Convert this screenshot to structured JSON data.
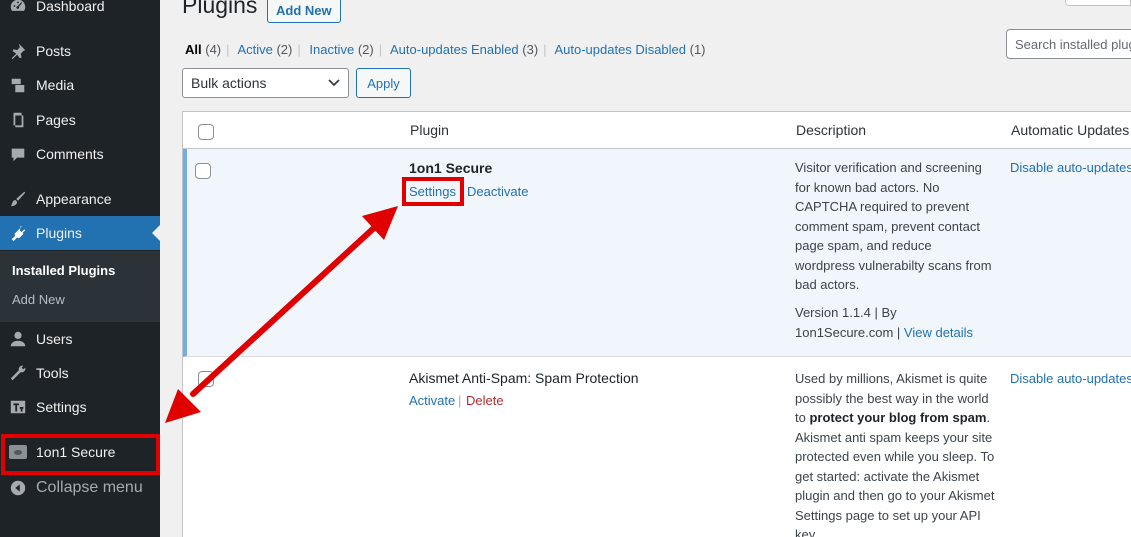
{
  "sidebar": {
    "items": [
      {
        "label": "Dashboard",
        "icon": "dashboard-icon"
      },
      {
        "label": "Posts",
        "icon": "pin-icon"
      },
      {
        "label": "Media",
        "icon": "media-icon"
      },
      {
        "label": "Pages",
        "icon": "pages-icon"
      },
      {
        "label": "Comments",
        "icon": "comment-icon"
      },
      {
        "label": "Appearance",
        "icon": "brush-icon"
      },
      {
        "label": "Plugins",
        "icon": "plugin-icon"
      },
      {
        "label": "Users",
        "icon": "user-icon"
      },
      {
        "label": "Tools",
        "icon": "wrench-icon"
      },
      {
        "label": "Settings",
        "icon": "settings-icon"
      },
      {
        "label": "1on1 Secure",
        "icon": "eye-icon"
      },
      {
        "label": "Collapse menu",
        "icon": "collapse-icon"
      }
    ],
    "submenu": [
      "Installed Plugins",
      "Add New"
    ]
  },
  "header": {
    "title": "Plugins",
    "add_new": "Add New",
    "search_placeholder": "Search installed plug"
  },
  "filters": [
    {
      "label": "All",
      "count": "(4)"
    },
    {
      "label": "Active",
      "count": "(2)"
    },
    {
      "label": "Inactive",
      "count": "(2)"
    },
    {
      "label": "Auto-updates Enabled",
      "count": "(3)"
    },
    {
      "label": "Auto-updates Disabled",
      "count": "(1)"
    }
  ],
  "bulk": {
    "selected": "Bulk actions",
    "apply": "Apply"
  },
  "table": {
    "columns": [
      "Plugin",
      "Description",
      "Automatic Updates"
    ],
    "rows": [
      {
        "name": "1on1 Secure",
        "actions": [
          "Settings",
          "Deactivate"
        ],
        "description": "Visitor verification and screening for known bad actors. No CAPTCHA required to prevent comment spam, prevent contact page spam, and reduce wordpress vulnerabilty scans from bad actors.",
        "version": "Version 1.1.4 | By 1on1Secure.com |",
        "view_details": "View details",
        "auto": "Disable auto-updates"
      },
      {
        "name": "Akismet Anti-Spam: Spam Protection",
        "actions": [
          "Activate",
          "Delete"
        ],
        "description_pre": "Used by millions, Akismet is quite possibly the best way in the world to ",
        "description_bold": "protect your blog from spam",
        "description_post": ". Akismet anti spam keeps your site protected even while you sleep. To get started: activate the Akismet plugin and then go to your Akismet Settings page to set up your API key.",
        "auto": "Disable auto-updates"
      }
    ]
  },
  "colors": {
    "accent": "#2271b1",
    "sidebar": "#1d2327",
    "annotation": "#e00000"
  }
}
